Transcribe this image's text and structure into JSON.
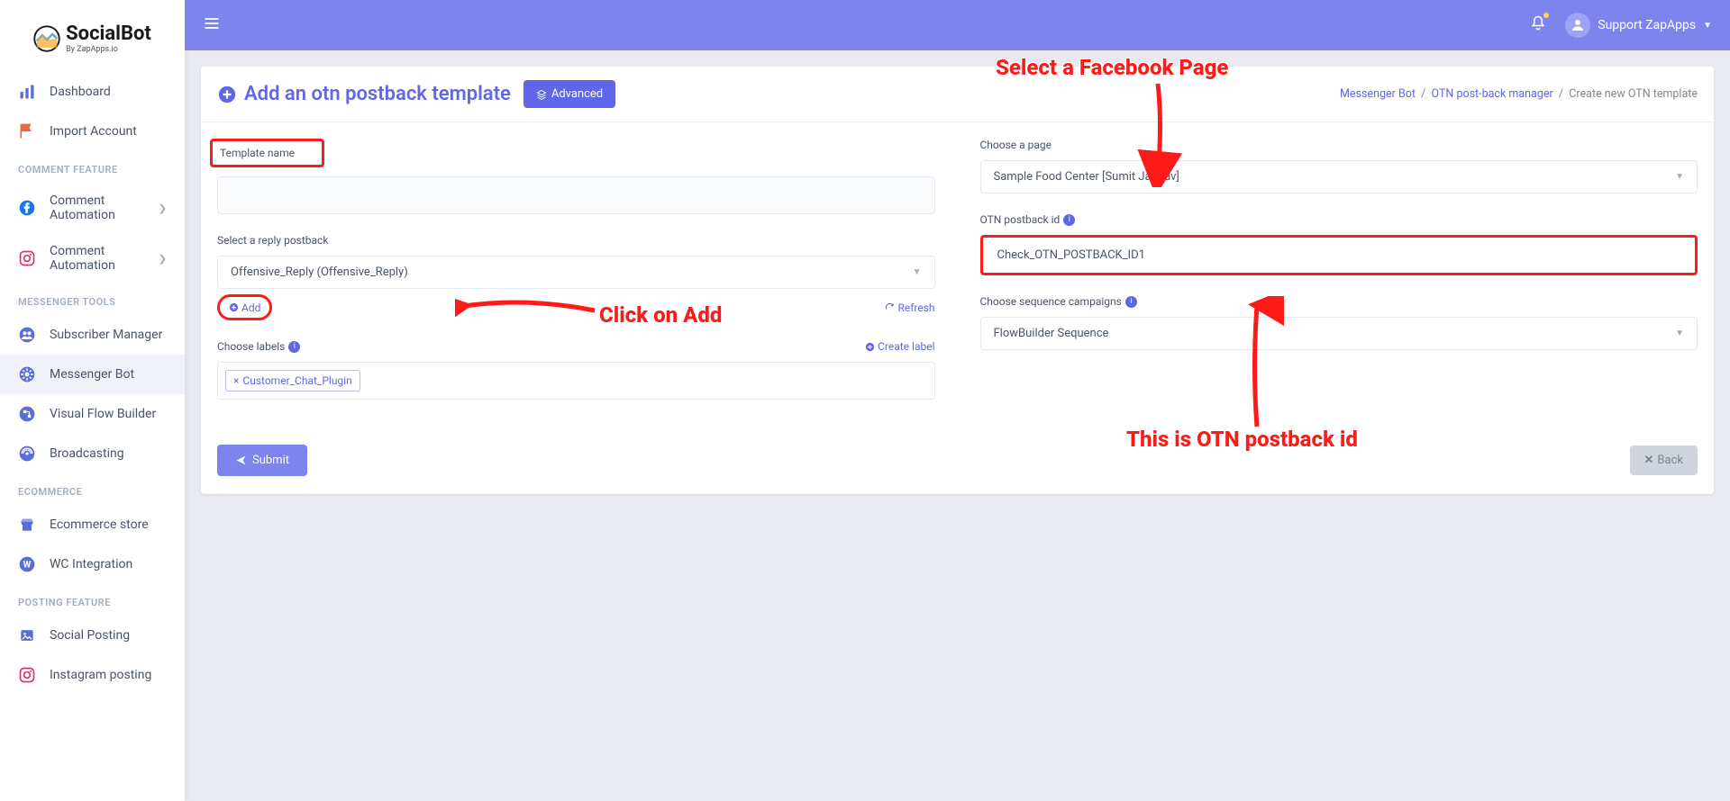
{
  "logo": {
    "main": "SocialBot",
    "sub": "By ZapApps.io"
  },
  "sidebar": {
    "items_top": [
      {
        "label": "Dashboard"
      },
      {
        "label": "Import Account"
      }
    ],
    "sections": [
      {
        "title": "COMMENT FEATURE",
        "items": [
          {
            "label": "Comment Automation",
            "chevron": true,
            "icon": "facebook"
          },
          {
            "label": "Comment Automation",
            "chevron": true,
            "icon": "instagram"
          }
        ]
      },
      {
        "title": "MESSENGER TOOLS",
        "items": [
          {
            "label": "Subscriber Manager",
            "icon": "users"
          },
          {
            "label": "Messenger Bot",
            "icon": "gear",
            "active": true
          },
          {
            "label": "Visual Flow Builder",
            "icon": "flow"
          },
          {
            "label": "Broadcasting",
            "icon": "broadcast"
          }
        ]
      },
      {
        "title": "ECOMMERCE",
        "items": [
          {
            "label": "Ecommerce store",
            "icon": "store"
          },
          {
            "label": "WC Integration",
            "icon": "wordpress"
          }
        ]
      },
      {
        "title": "POSTING FEATURE",
        "items": [
          {
            "label": "Social Posting",
            "icon": "image"
          },
          {
            "label": "Instagram posting",
            "icon": "instagram"
          }
        ]
      }
    ]
  },
  "user": {
    "name": "Support ZapApps"
  },
  "page": {
    "title": "Add an otn postback template",
    "advanced_btn": "Advanced",
    "breadcrumb": {
      "a": "Messenger Bot",
      "b": "OTN post-back manager",
      "c": "Create new OTN template"
    }
  },
  "form": {
    "template_name_label": "Template name",
    "template_name_value": "",
    "reply_postback_label": "Select a reply postback",
    "reply_postback_value": "Offensive_Reply (Offensive_Reply)",
    "add_link": "Add",
    "refresh_link": "Refresh",
    "choose_labels_label": "Choose labels",
    "create_label_link": "Create label",
    "tag": "Customer_Chat_Plugin",
    "choose_page_label": "Choose a page",
    "choose_page_value": "Sample Food Center [Sumit Jadhav]",
    "otn_id_label": "OTN postback id",
    "otn_id_value": "Check_OTN_POSTBACK_ID1",
    "sequence_label": "Choose sequence campaigns",
    "sequence_value": "FlowBuilder Sequence",
    "submit": "Submit",
    "back": "Back"
  },
  "annotations": {
    "select_page": "Select a Facebook Page",
    "click_add": "Click on Add",
    "otn_id": "This is OTN postback id"
  }
}
